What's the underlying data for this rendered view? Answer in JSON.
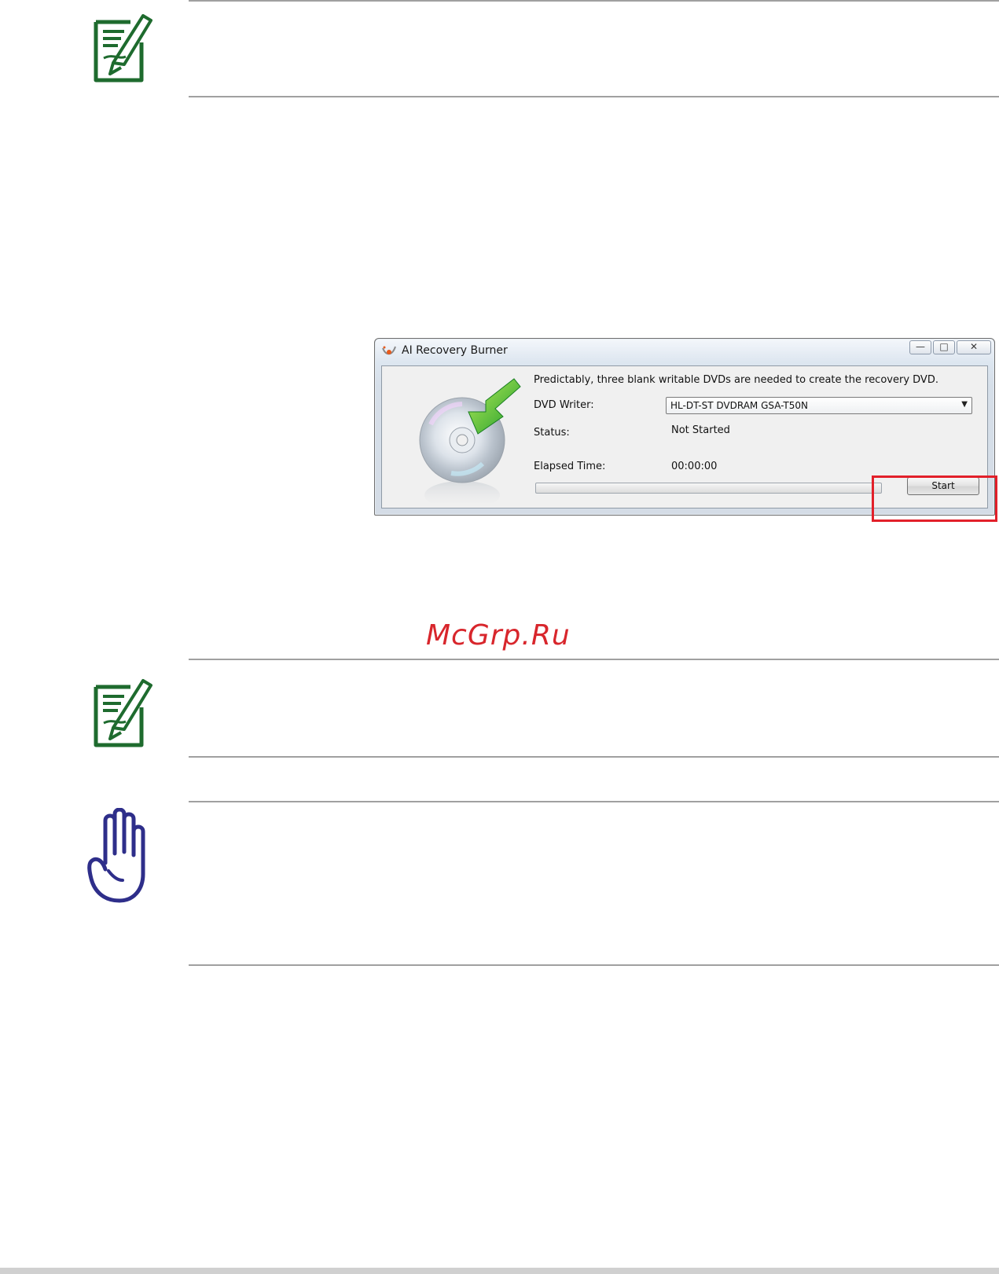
{
  "dialog": {
    "title": "AI Recovery Burner",
    "window_buttons": {
      "minimize": "—",
      "maximize": "□",
      "close": "✕"
    },
    "info_text": "Predictably, three blank writable DVDs are needed to create the recovery DVD.",
    "dvd_writer_label": "DVD Writer:",
    "dvd_writer_value": "HL-DT-ST DVDRAM GSA-T50N",
    "status_label": "Status:",
    "status_value": "Not Started",
    "elapsed_label": "Elapsed Time:",
    "elapsed_value": "00:00:00",
    "progress_fraction": 0,
    "start_button": "Start"
  },
  "watermark": "McGrp.Ru",
  "icons": {
    "note": "note-pencil-icon",
    "important": "raised-hand-icon",
    "app": "ai-recovery-logo-icon",
    "disc": "dvd-disc-arrow-icon"
  },
  "colors": {
    "note_icon": "#1e6b2e",
    "hand_icon": "#2e2e8a",
    "highlight": "#e2202a",
    "watermark": "#d8262c"
  }
}
